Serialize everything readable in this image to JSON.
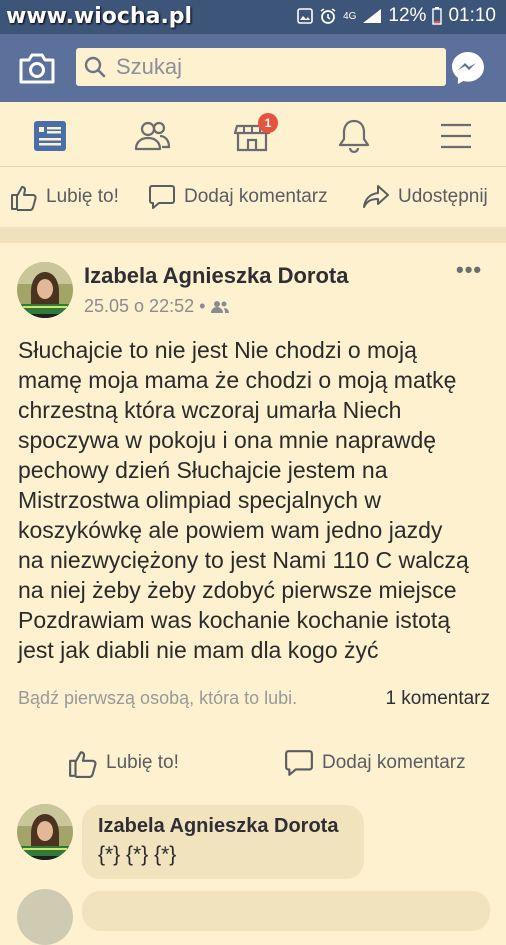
{
  "statusbar": {
    "watermark": "www.wiocha.pl",
    "network": "4G",
    "battery": "12%",
    "time": "01:10"
  },
  "search": {
    "placeholder": "Szukaj"
  },
  "nav": {
    "notification_badge": "1",
    "icons": [
      "news-feed-icon",
      "friends-icon",
      "marketplace-icon",
      "notifications-icon",
      "menu-icon"
    ]
  },
  "top_actions": {
    "like": "Lubię to!",
    "comment": "Dodaj komentarz",
    "share": "Udostępnij"
  },
  "post": {
    "author": "Izabela Agnieszka Dorota",
    "timestamp": "25.05 o 22:52 •",
    "body_lines": [
      "Słuchajcie to nie jest Nie chodzi o moją",
      "mamę moja mama że chodzi o moją matkę",
      "chrzestną która wczoraj umarła Niech",
      "spoczywa w pokoju i ona mnie naprawdę",
      "pechowy dzień Słuchajcie jestem na",
      "Mistrzostwa olimpiad specjalnych w",
      "koszykówkę ale powiem wam jedno jazdy",
      "na niezwyciężony to jest Nami 110 C walczą",
      "na niej żeby żeby zdobyć pierwsze miejsce",
      "Pozdrawiam was kochanie kochanie istotą",
      "jest jak diabli nie mam dla kogo żyć"
    ],
    "likes_summary": "Bądź pierwszą osobą, która to lubi.",
    "comments_count": "1 komentarz",
    "like": "Lubię to!",
    "comment": "Dodaj komentarz"
  },
  "comment": {
    "author": "Izabela Agnieszka Dorota",
    "text": "{*} {*} {*}"
  },
  "colors": {
    "statusbar": "#3d5578",
    "searchbar": "#5b709a",
    "background": "#fdf1cf",
    "accent": "#4a6ea8",
    "badge": "#e8533d"
  }
}
